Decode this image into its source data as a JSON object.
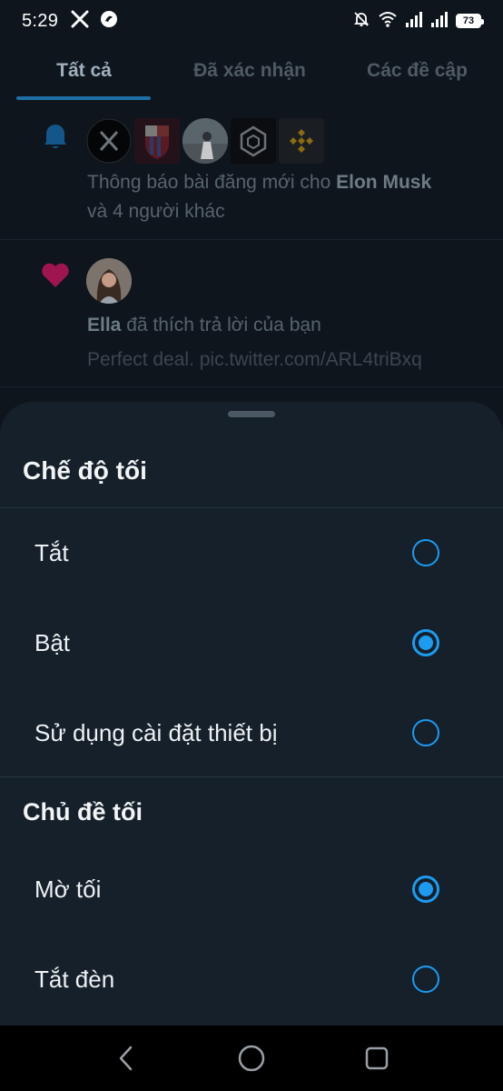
{
  "status_bar": {
    "time": "5:29",
    "battery": "73",
    "icons": [
      "x-logo-icon",
      "app-icon",
      "bell-off-icon",
      "wifi-icon",
      "signal-icon",
      "signal-icon",
      "battery-icon"
    ]
  },
  "tabs": [
    {
      "label": "Tất cả",
      "active": true
    },
    {
      "label": "Đã xác nhận",
      "active": false
    },
    {
      "label": "Các đề cập",
      "active": false
    }
  ],
  "notifications": [
    {
      "type_icon": "bell-icon",
      "avatars": [
        "x-logo-avatar",
        "fc-barcelona-avatar",
        "person-avatar",
        "cube-logo-avatar",
        "binance-logo-avatar"
      ],
      "text_prefix": "Thông báo bài đăng mới cho ",
      "text_bold": "Elon Musk",
      "text_suffix": "và 4 người khác"
    },
    {
      "type_icon": "heart-icon",
      "avatars": [
        "ella-avatar"
      ],
      "text_bold": "Ella",
      "text_suffix": " đã thích trả lời của bạn",
      "subtext": "Perfect deal. pic.twitter.com/ARL4triBxq"
    }
  ],
  "sheet": {
    "title": "Chế độ tối",
    "dark_mode_options": [
      {
        "label": "Tắt",
        "selected": false
      },
      {
        "label": "Bật",
        "selected": true
      },
      {
        "label": "Sử dụng cài đặt thiết bị",
        "selected": false
      }
    ],
    "theme_title": "Chủ đề tối",
    "theme_options": [
      {
        "label": "Mờ tối",
        "selected": true
      },
      {
        "label": "Tắt đèn",
        "selected": false
      }
    ]
  },
  "nav": {
    "icons": [
      "back-icon",
      "home-icon",
      "recents-icon"
    ]
  },
  "colors": {
    "accent": "#1d9bf0",
    "sheet_bg": "#15202b",
    "heart": "#c2185b"
  }
}
